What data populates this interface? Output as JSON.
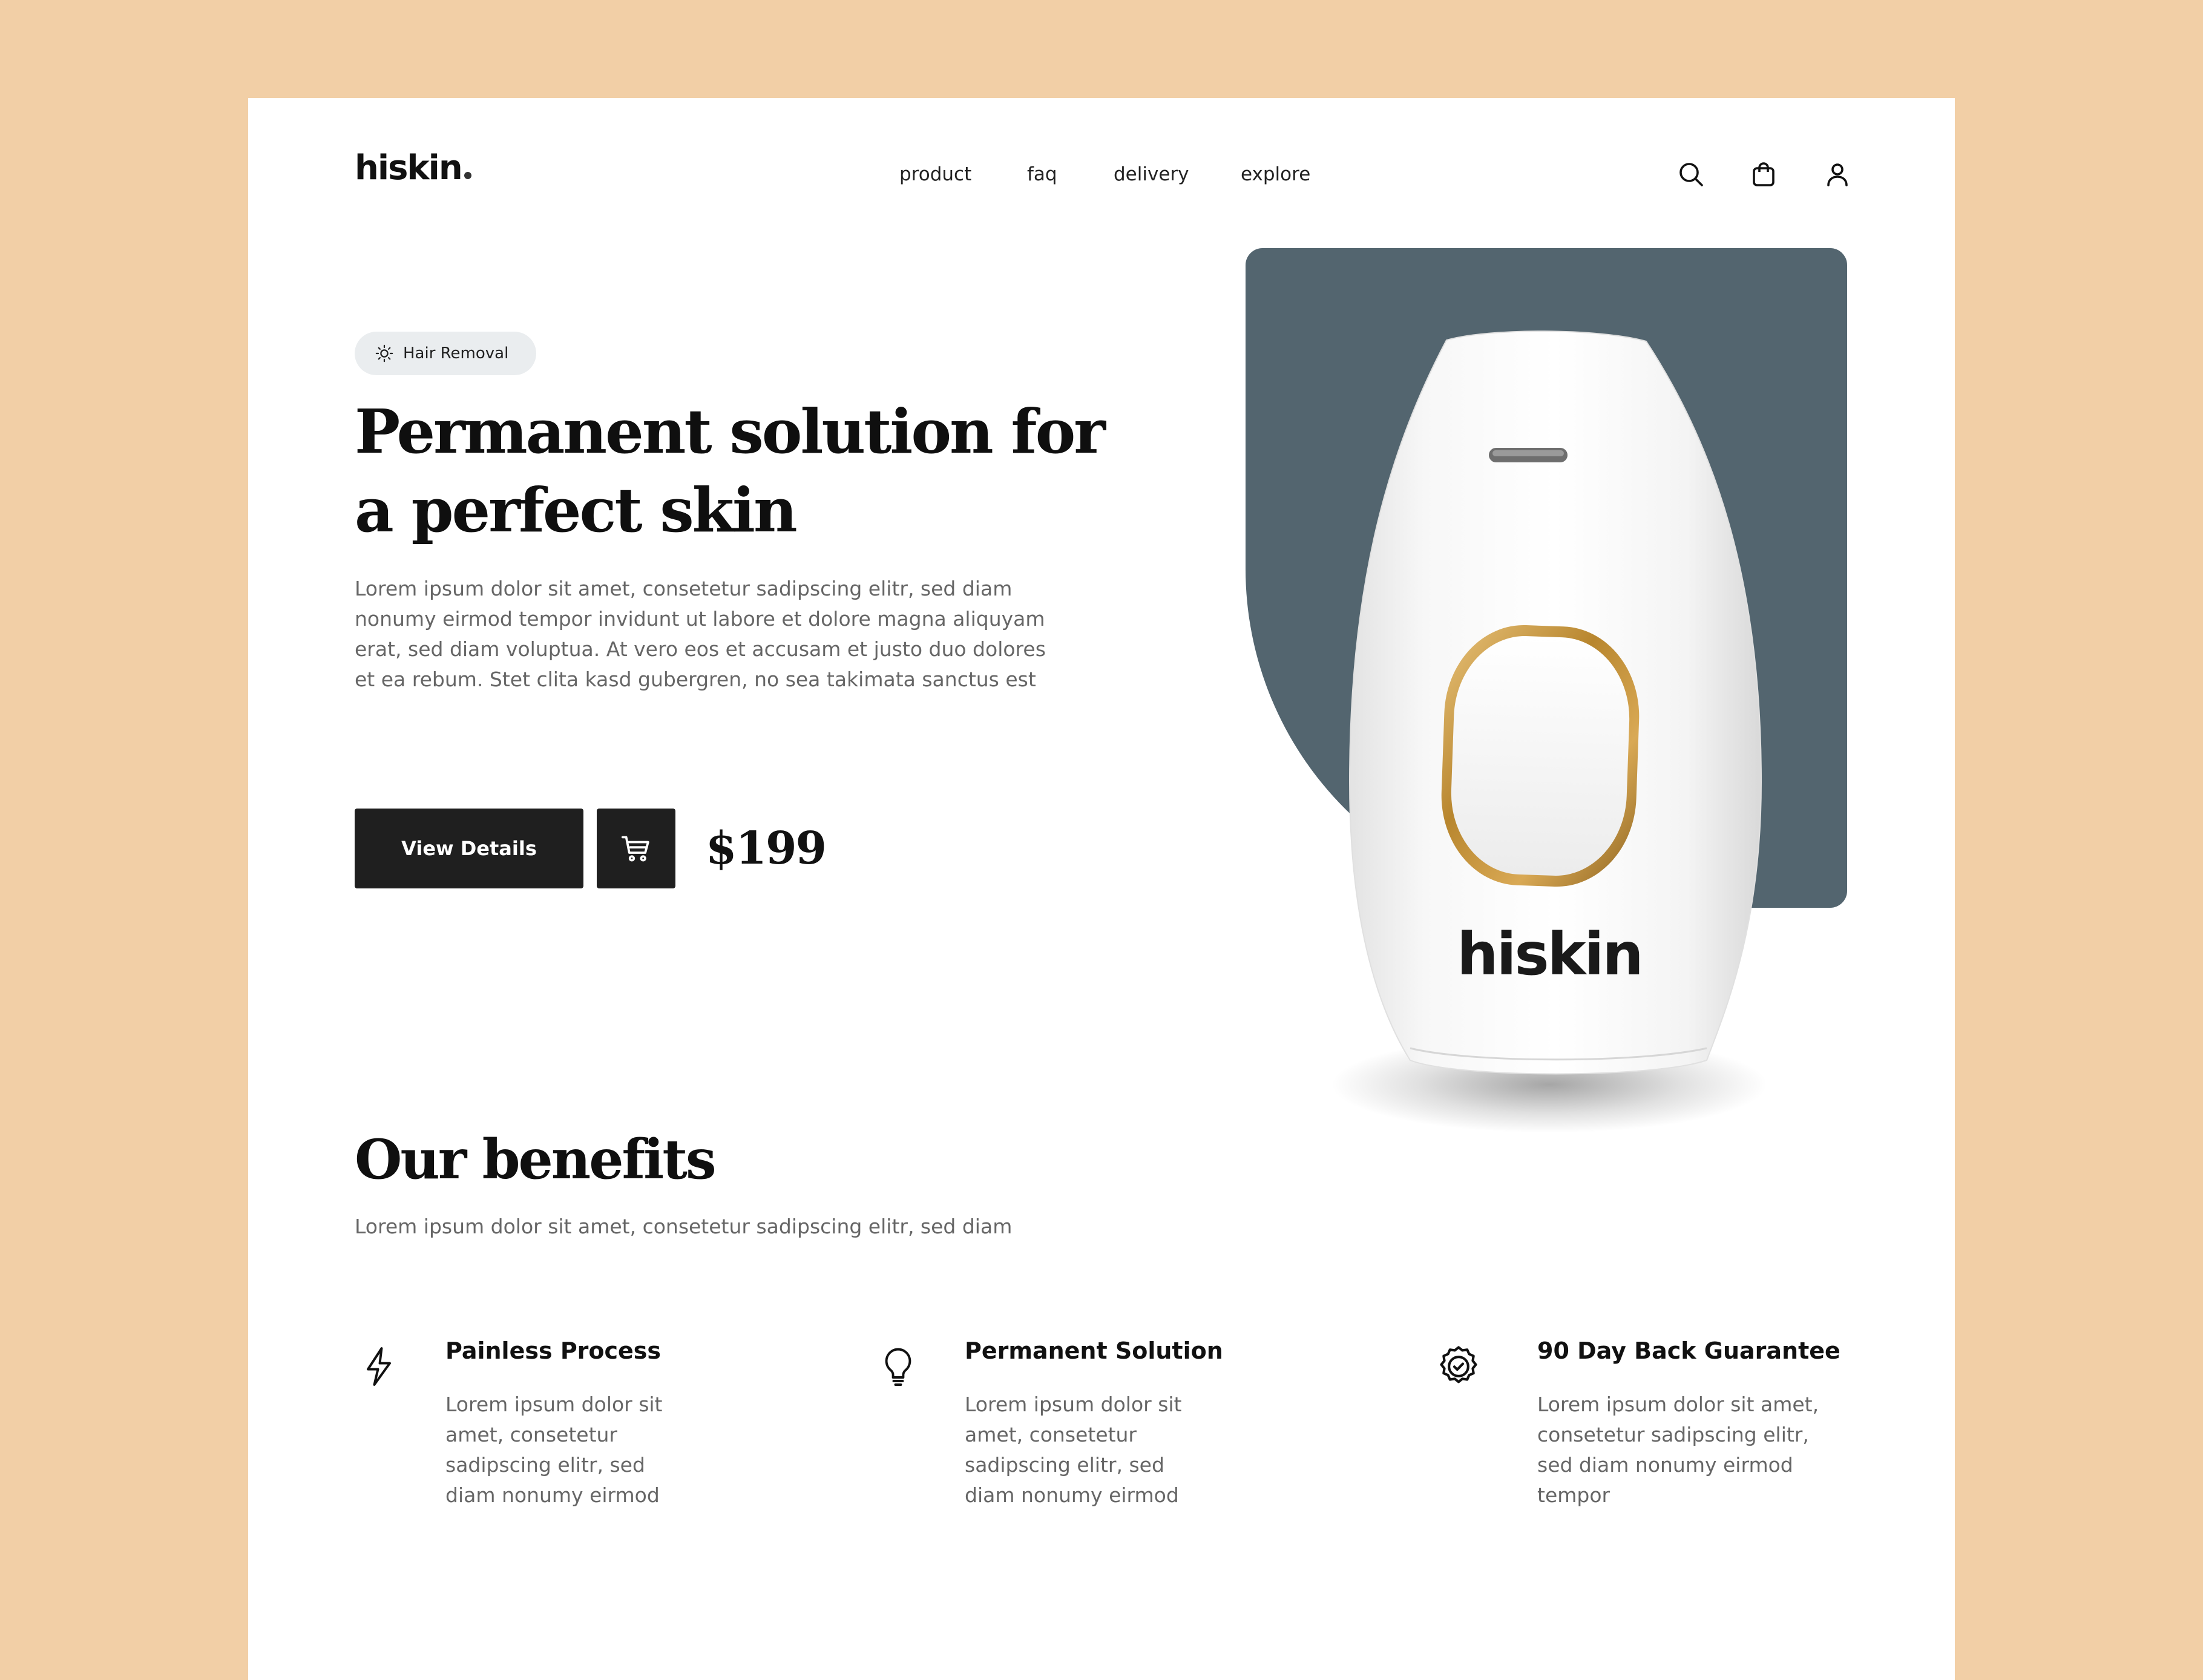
{
  "header": {
    "logo_text": "hiskin",
    "nav": [
      "product",
      "faq",
      "delivery",
      "explore"
    ],
    "icons": [
      "search-icon",
      "shopping-bag-icon",
      "user-icon"
    ]
  },
  "hero": {
    "tag_icon": "sun-icon",
    "tag_label": "Hair Removal",
    "title": "Permanent solution for a perfect skin",
    "description": "Lorem ipsum dolor sit amet, consetetur sadipscing elitr, sed diam nonumy eirmod tempor invidunt ut labore et dolore magna aliquyam erat, sed diam voluptua. At vero eos et accusam et justo duo dolores et ea rebum. Stet clita kasd gubergren, no sea takimata sanctus est",
    "view_details_label": "View Details",
    "cart_icon": "cart-icon",
    "price": "$199"
  },
  "product": {
    "brand_text": "hiskin",
    "colors": {
      "panel": "#53656F",
      "device": "#FFFFFF",
      "ring": "#C8973A"
    }
  },
  "benefits": {
    "title": "Our benefits",
    "subtitle": "Lorem ipsum dolor sit amet, consetetur sadipscing elitr, sed diam",
    "items": [
      {
        "icon": "lightning-icon",
        "title": "Painless Process",
        "text": "Lorem ipsum dolor sit amet, consetetur sadipscing elitr, sed diam nonumy eirmod"
      },
      {
        "icon": "lightbulb-icon",
        "title": "Permanent Solution",
        "text": "Lorem ipsum dolor sit amet, consetetur sadipscing elitr, sed diam nonumy eirmod"
      },
      {
        "icon": "badge-check-icon",
        "title": "90 Day Back Guarantee",
        "text": "Lorem ipsum dolor sit amet, consetetur sadipscing elitr, sed diam nonumy eirmod tempor"
      }
    ]
  },
  "colors": {
    "background": "#F2CFA6",
    "page": "#FFFFFF",
    "button": "#1F1F1F",
    "tag_bg": "#EAEDEF",
    "text_muted": "#666666"
  }
}
